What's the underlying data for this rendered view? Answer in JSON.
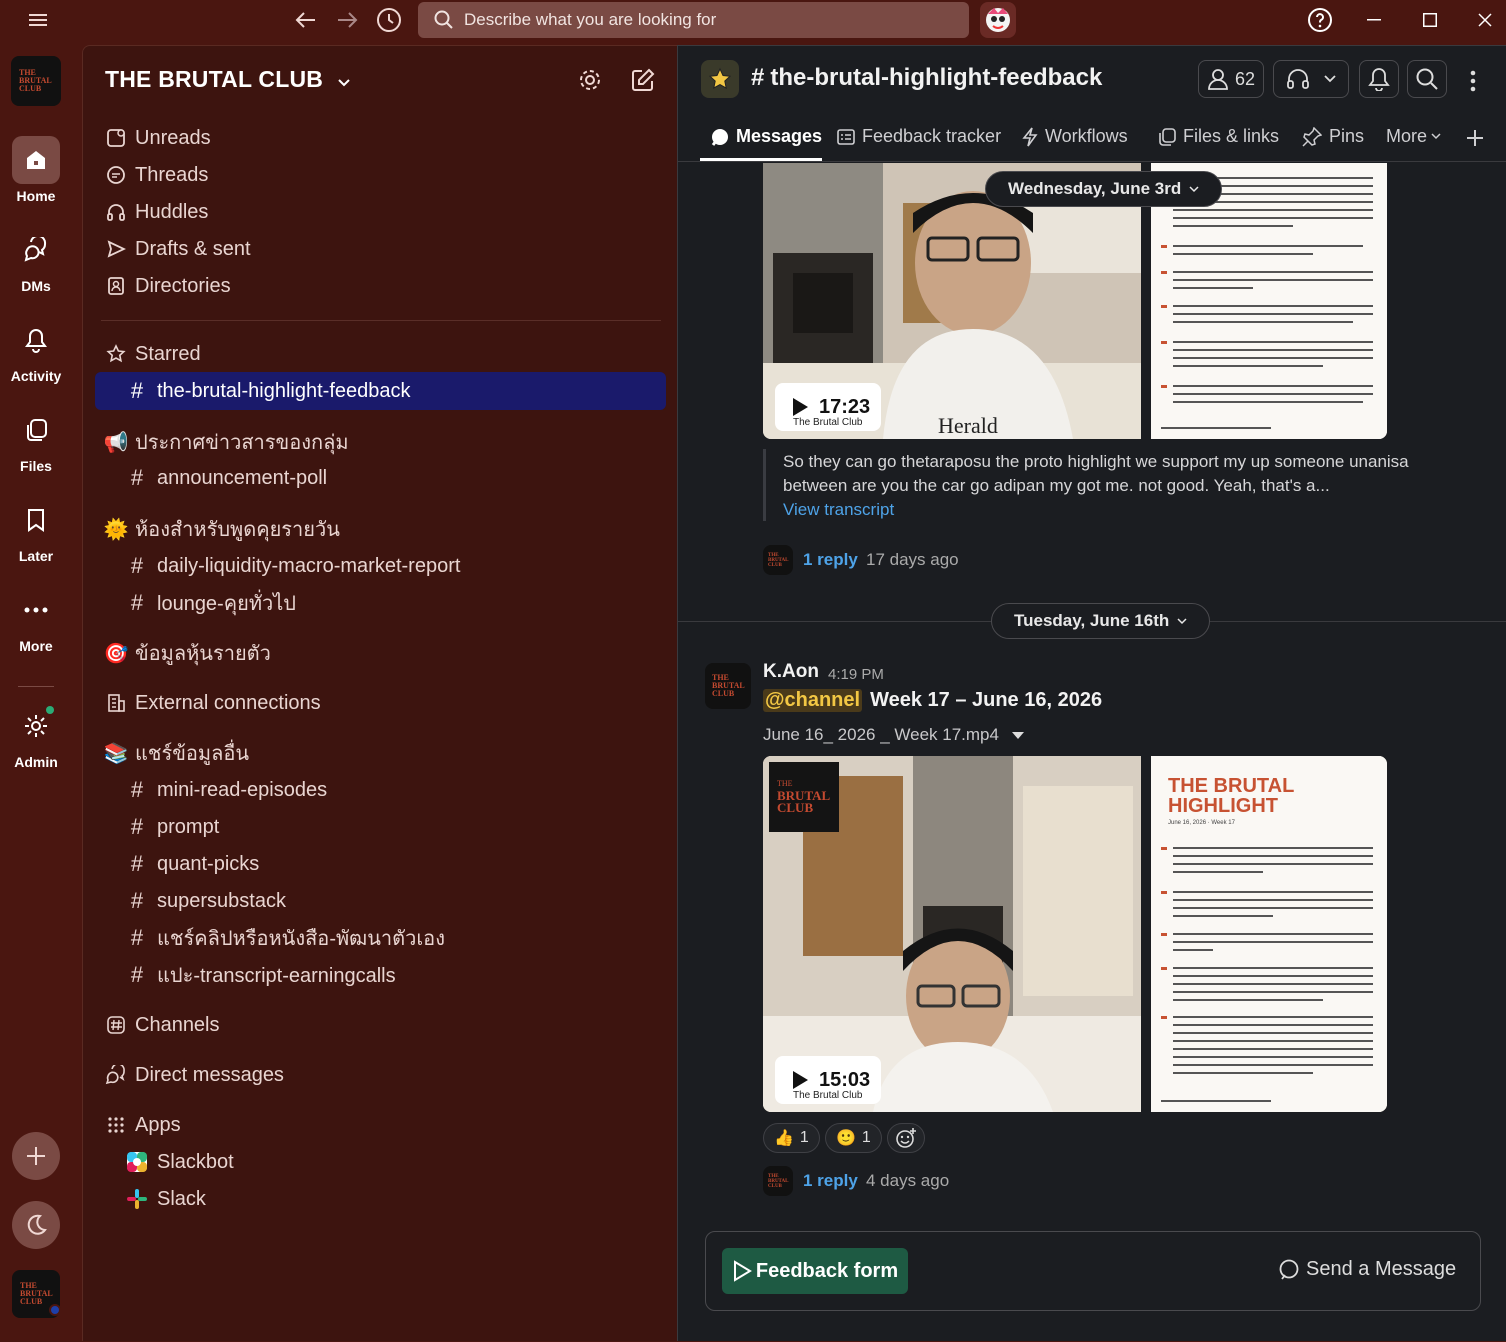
{
  "topbar": {
    "search_placeholder": "Describe what you are looking for"
  },
  "rail": {
    "items": [
      {
        "label": "Home"
      },
      {
        "label": "DMs"
      },
      {
        "label": "Activity"
      },
      {
        "label": "Files"
      },
      {
        "label": "Later"
      },
      {
        "label": "More"
      },
      {
        "label": "Admin"
      }
    ],
    "logo_text": "THE BRUTAL CLUB"
  },
  "sidebar": {
    "workspace": "THE BRUTAL CLUB",
    "nav": [
      "Unreads",
      "Threads",
      "Huddles",
      "Drafts & sent",
      "Directories"
    ],
    "starred_label": "Starred",
    "starred_channel": "the-brutal-highlight-feedback",
    "sec1_label": "ประกาศข่าวสารของกลุ่ม",
    "sec1_channels": [
      "announcement-poll"
    ],
    "sec2_label": "ห้องสำหรับพูดคุยรายวัน",
    "sec2_channels": [
      "daily-liquidity-macro-market-report",
      "lounge-คุยทั่วไป"
    ],
    "sec3_label": "ข้อมูลหุ้นรายตัว",
    "external": "External connections",
    "sec4_label": "แชร์ข้อมูลอื่น",
    "sec4_channels": [
      "mini-read-episodes",
      "prompt",
      "quant-picks",
      "supersubstack",
      "แชร์คลิปหรือหนังสือ-พัฒนาตัวเอง",
      "แปะ-transcript-earningcalls"
    ],
    "channels": "Channels",
    "dms": "Direct messages",
    "apps": "Apps",
    "app_items": [
      "Slackbot",
      "Slack"
    ]
  },
  "channel": {
    "name": "the-brutal-highlight-feedback",
    "member_count": "62",
    "tabs": [
      "Messages",
      "Feedback tracker",
      "Workflows",
      "Files & links",
      "Pins",
      "More"
    ]
  },
  "messages": {
    "date1": "Wednesday, June 3rd",
    "video1_duration": "17:23",
    "video1_caption": "The Brutal Club",
    "transcript": "So they can go thetaraposu the proto highlight we support my up someone unanisa between are you the car go adipan my got me. not good. Yeah, that's a...",
    "view_transcript": "View transcript",
    "reply1_count": "1 reply",
    "reply1_time": "17 days ago",
    "date2": "Tuesday, June 16th",
    "author": "K.Aon",
    "time": "4:19 PM",
    "mention": "@channel",
    "title": "Week 17 – June 16, 2026",
    "file_name": "June 16_ 2026 _ Week 17.mp4",
    "video2_duration": "15:03",
    "video2_caption": "The Brutal Club",
    "slide_title1": "THE BRUTAL",
    "slide_title2": "HIGHLIGHT",
    "slide_date": "June 16, 2026 · Week 17",
    "reaction1": {
      "emoji": "👍",
      "count": "1"
    },
    "reaction2": {
      "emoji": "🙂",
      "count": "1"
    },
    "reply2_count": "1 reply",
    "reply2_time": "4 days ago"
  },
  "composer": {
    "feedback_button": "Feedback form",
    "send_button": "Send a Message"
  },
  "colors": {
    "rail_bg": "#4a1610",
    "sidebar_bg": "#3d140f",
    "selected": "#1a1a6b",
    "link": "#4ea3e8",
    "feedback_btn": "#1e5a43"
  }
}
